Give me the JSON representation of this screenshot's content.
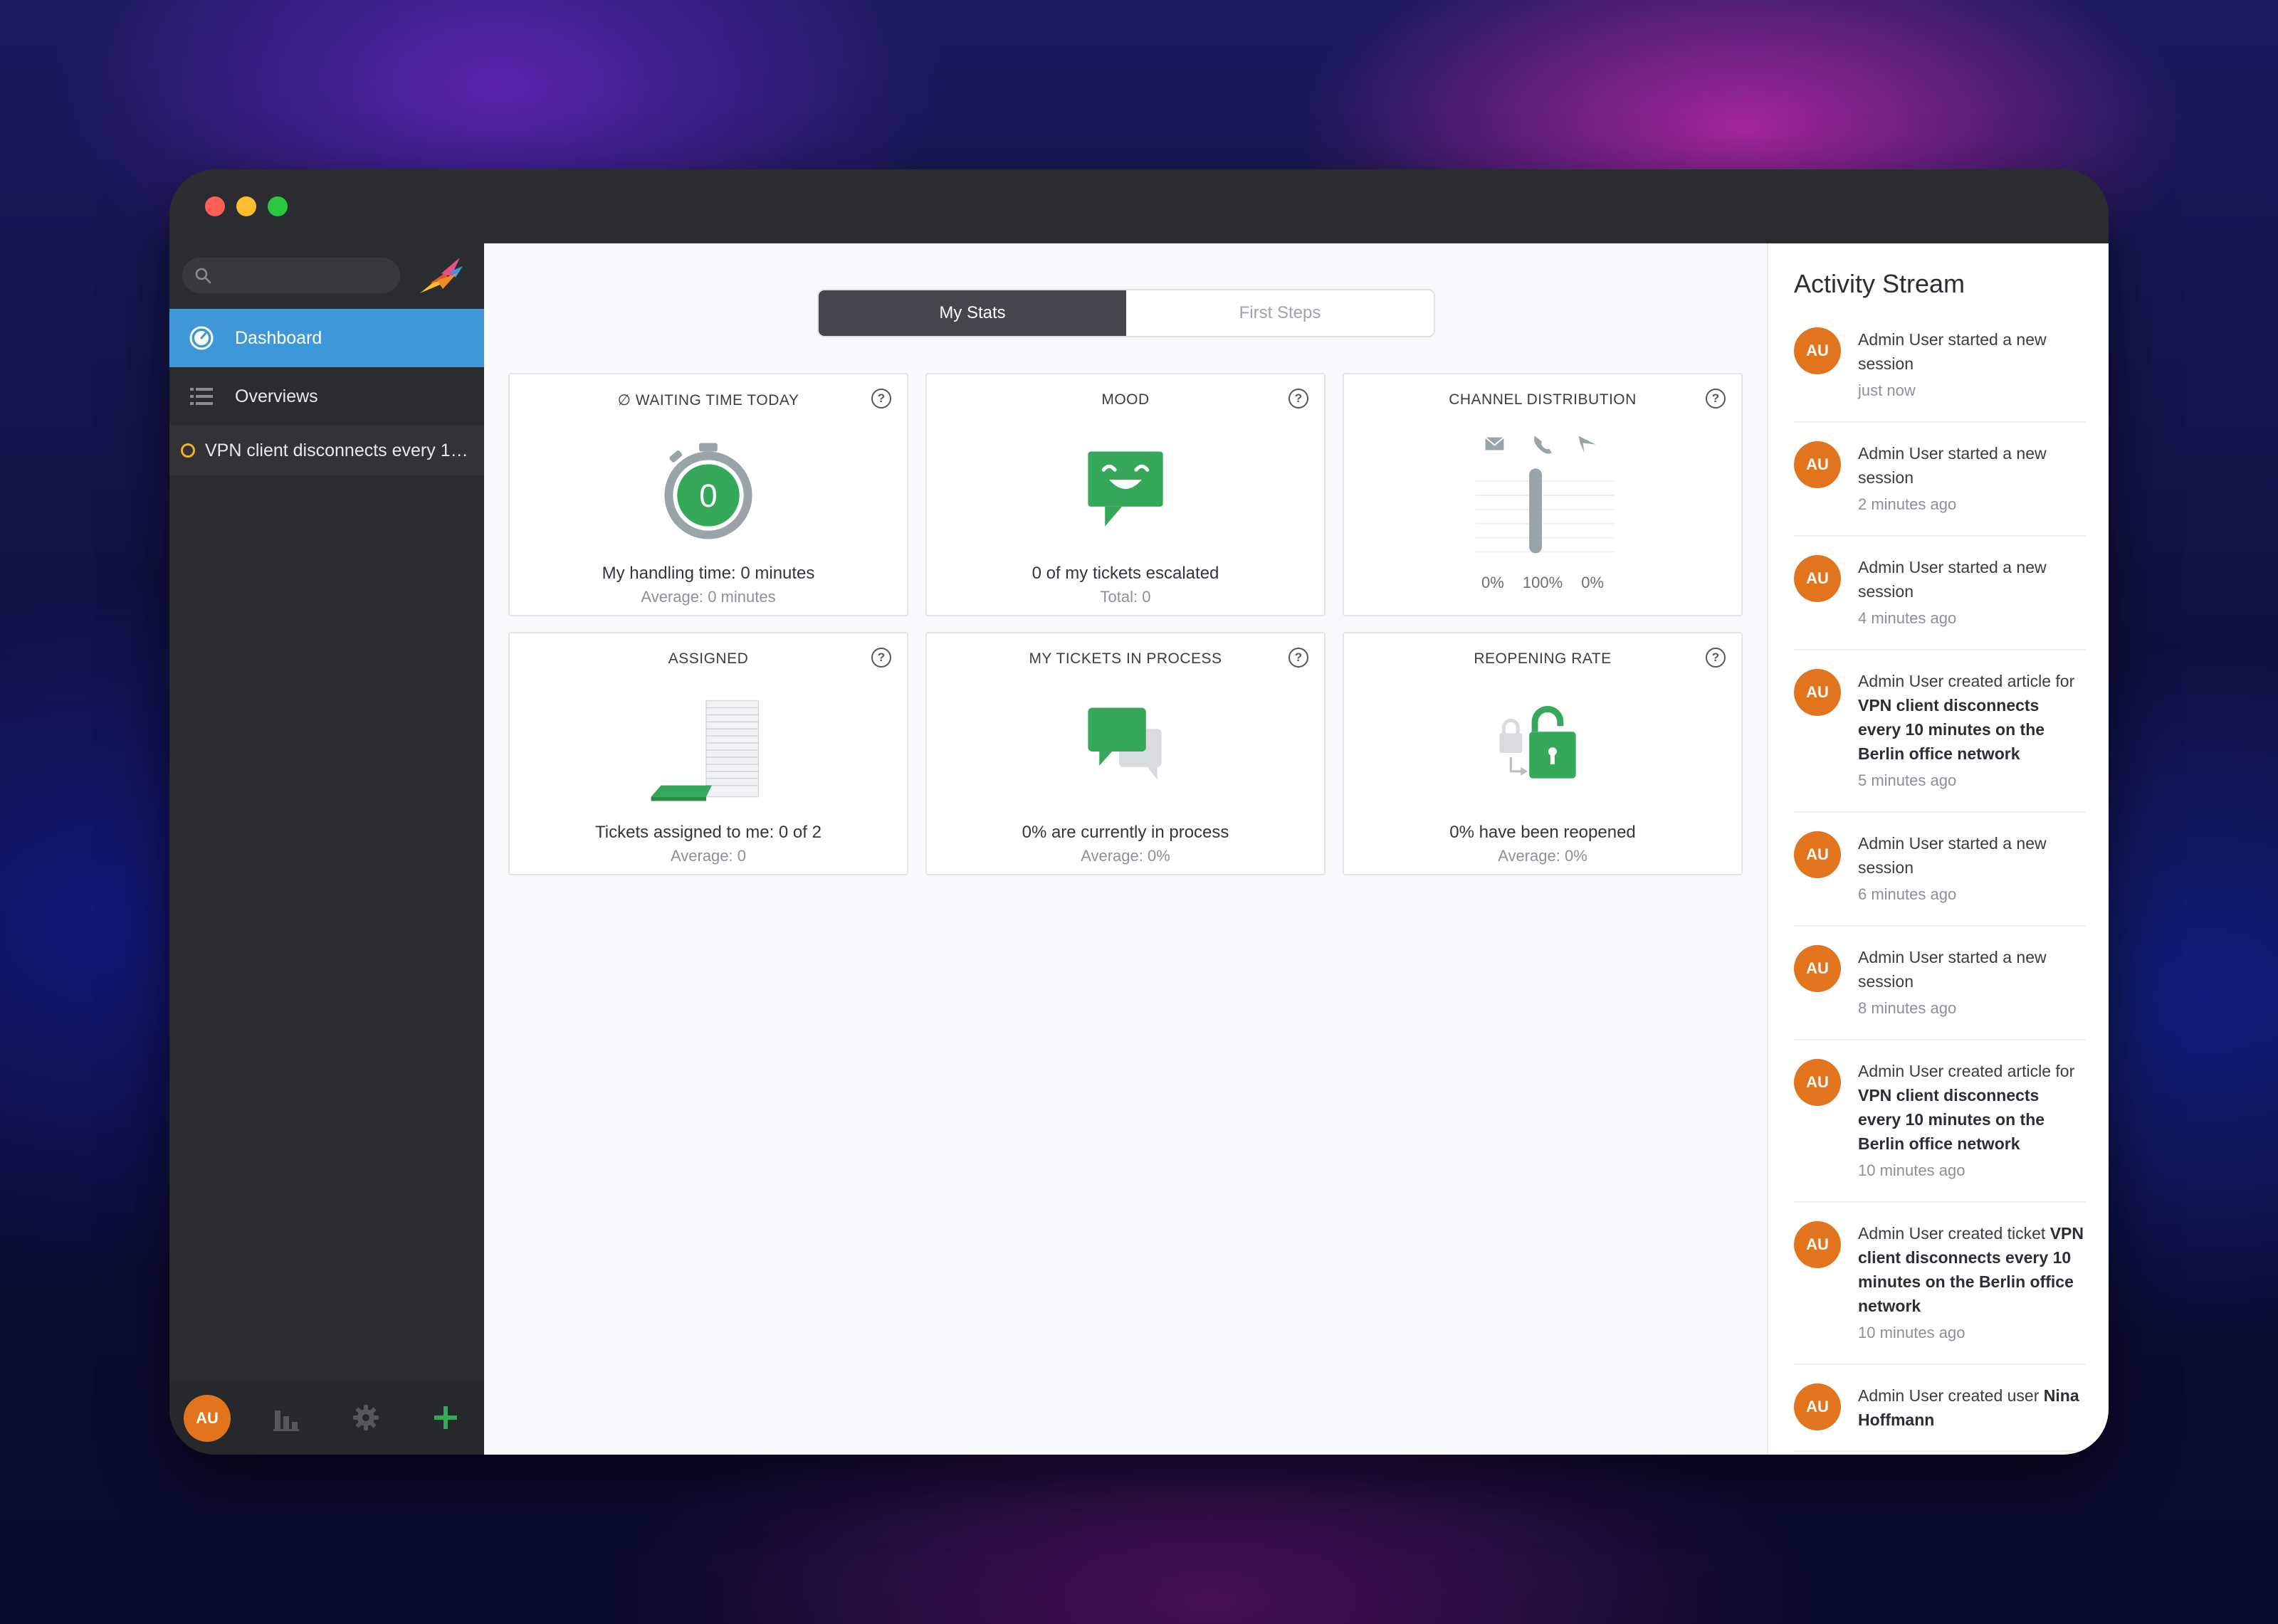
{
  "sidebar": {
    "search_placeholder": "",
    "nav": {
      "dashboard": "Dashboard",
      "overviews": "Overviews",
      "ticket": "VPN client disconnects every 10 ..."
    },
    "user_initials": "AU"
  },
  "tabs": {
    "my_stats": "My Stats",
    "first_steps": "First Steps"
  },
  "cards": {
    "waiting_time": {
      "title": "∅ Waiting time today",
      "counter": "0",
      "line1": "My handling time: 0 minutes",
      "line2": "Average: 0 minutes"
    },
    "mood": {
      "title": "Mood",
      "line1": "0 of my tickets escalated",
      "line2": "Total: 0"
    },
    "channel": {
      "title": "Channel Distribution",
      "email_pct": "0%",
      "phone_pct": "100%",
      "other_pct": "0%"
    },
    "assigned": {
      "title": "Assigned",
      "line1": "Tickets assigned to me: 0 of 2",
      "line2": "Average: 0"
    },
    "in_process": {
      "title": "My tickets in process",
      "line1": "0% are currently in process",
      "line2": "Average: 0%"
    },
    "reopening": {
      "title": "Reopening rate",
      "line1": "0% have been reopened",
      "line2": "Average: 0%"
    },
    "help_symbol": "?"
  },
  "activity": {
    "title": "Activity Stream",
    "items": [
      {
        "initials": "AU",
        "text": "Admin User started a new session",
        "bold": "",
        "time": "just now"
      },
      {
        "initials": "AU",
        "text": "Admin User started a new session",
        "bold": "",
        "time": "2 minutes ago"
      },
      {
        "initials": "AU",
        "text": "Admin User started a new session",
        "bold": "",
        "time": "4 minutes ago"
      },
      {
        "initials": "AU",
        "text": "Admin User created article for ",
        "bold": "VPN client disconnects every 10 minutes on the Berlin office network",
        "time": "5 minutes ago"
      },
      {
        "initials": "AU",
        "text": "Admin User started a new session",
        "bold": "",
        "time": "6 minutes ago"
      },
      {
        "initials": "AU",
        "text": "Admin User started a new session",
        "bold": "",
        "time": "8 minutes ago"
      },
      {
        "initials": "AU",
        "text": "Admin User created article for ",
        "bold": "VPN client disconnects every 10 minutes on the Berlin office network",
        "time": "10 minutes ago"
      },
      {
        "initials": "AU",
        "text": "Admin User created ticket ",
        "bold": "VPN client disconnects every 10 minutes on the Berlin office network",
        "time": "10 minutes ago"
      },
      {
        "initials": "AU",
        "text": "Admin User created user ",
        "bold": "Nina Hoffmann",
        "time": ""
      }
    ]
  },
  "colors": {
    "accent": "#3e97d8",
    "green": "#36a85a",
    "avatar": "#e2741d"
  }
}
